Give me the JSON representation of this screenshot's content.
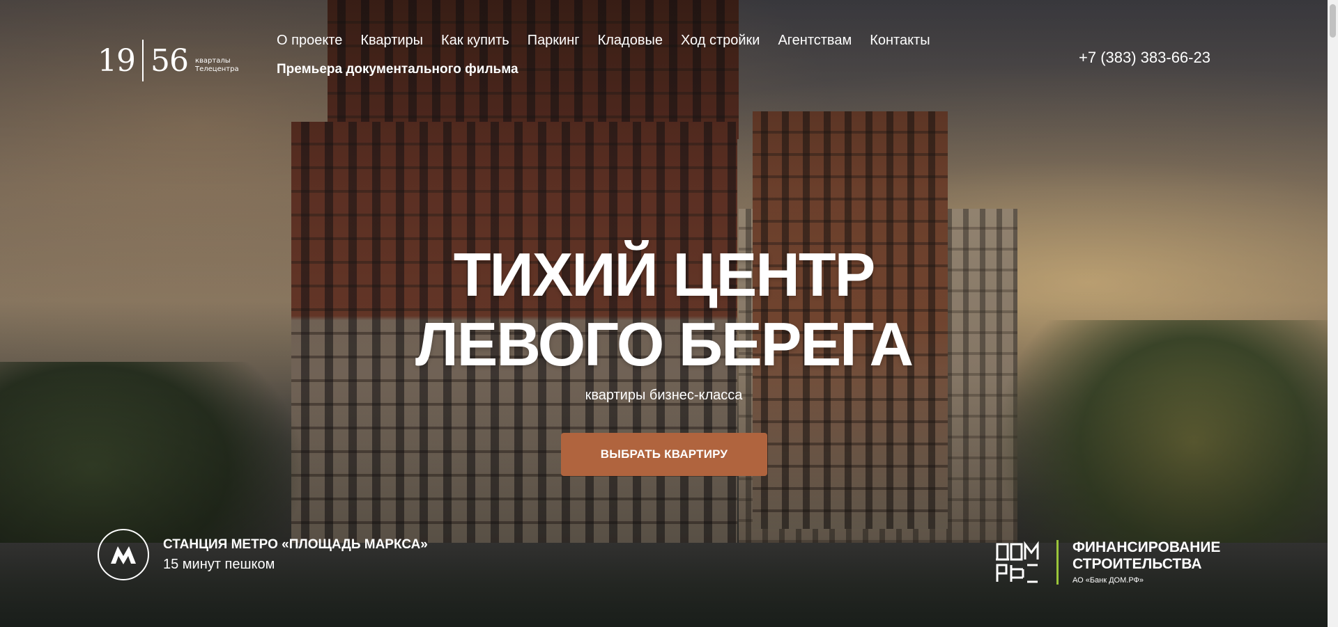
{
  "logo": {
    "left_digits": "19",
    "right_digits": "56",
    "subtitle_line1": "кварталы",
    "subtitle_line2": "Телецентра"
  },
  "nav": {
    "items": [
      "О проекте",
      "Квартиры",
      "Как купить",
      "Паркинг",
      "Кладовые",
      "Ход стройки",
      "Агентствам",
      "Контакты"
    ],
    "film_link": "Премьера документального фильма"
  },
  "phone": "+7 (383) 383-66-23",
  "hero": {
    "headline_line1": "ТИХИЙ ЦЕНТР",
    "headline_line2": "ЛЕВОГО БЕРЕГА",
    "subheadline": "квартиры бизнес-класса",
    "cta_label": "ВЫБРАТЬ КВАРТИРУ"
  },
  "metro": {
    "icon": "metro-icon",
    "letter": "М",
    "title": "СТАНЦИЯ МЕТРО «ПЛОЩАДЬ МАРКСА»",
    "subtitle": "15 минут пешком"
  },
  "partner": {
    "logo_line1": "ДОМ",
    "logo_line2": "РФ",
    "title_line1": "ФИНАНСИРОВАНИЕ",
    "title_line2": "СТРОИТЕЛЬСТВА",
    "subtitle": "АО «Банк ДОМ.РФ»"
  },
  "colors": {
    "cta": "#b0643e",
    "partner_accent": "#9ac53a",
    "text": "#ffffff"
  }
}
